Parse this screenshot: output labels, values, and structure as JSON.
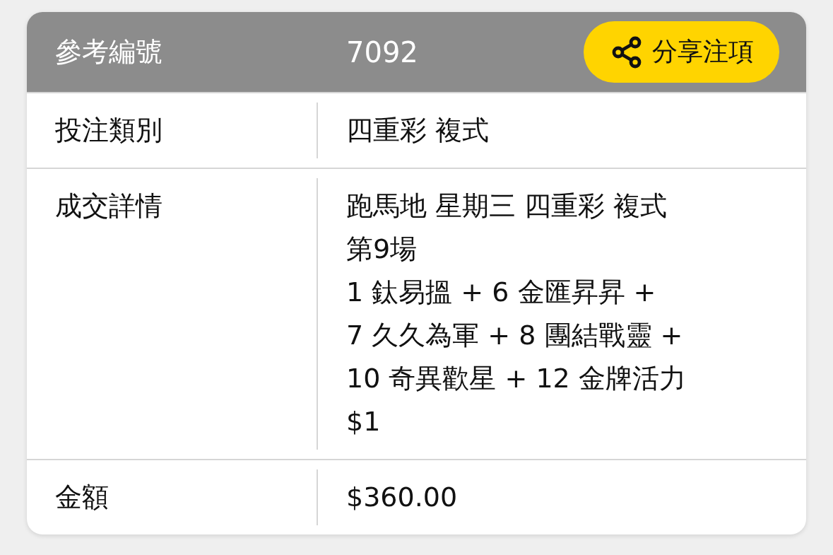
{
  "header": {
    "label": "參考編號",
    "value": "7092",
    "share_button": "分享注項"
  },
  "rows": [
    {
      "label": "投注類別",
      "lines": [
        "四重彩 複式"
      ]
    },
    {
      "label": "成交詳情",
      "lines": [
        "跑馬地 星期三 四重彩 複式",
        "第9場",
        "1 鈦易搵 + 6 金匯昇昇 +",
        "7 久久為軍 + 8 團結戰靈 +",
        "10 奇異歡星 + 12 金牌活力",
        "$1"
      ]
    },
    {
      "label": "金額",
      "lines": [
        "$360.00"
      ]
    }
  ]
}
